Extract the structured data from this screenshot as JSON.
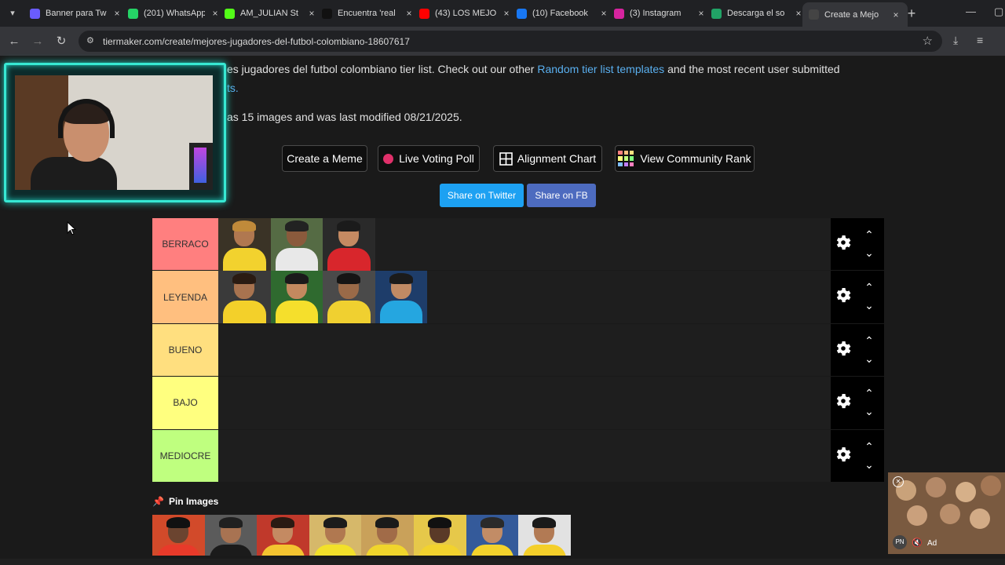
{
  "browser": {
    "tabs": [
      {
        "label": "Banner para Tw",
        "icon": "heart-icon",
        "color": "#6a5cff"
      },
      {
        "label": "(201) WhatsApp",
        "icon": "whatsapp-icon",
        "color": "#25d366"
      },
      {
        "label": "AM_JULIAN St",
        "icon": "kick-icon",
        "color": "#53fc18"
      },
      {
        "label": "Encuentra 'real",
        "icon": "tiktok-icon",
        "color": "#111111"
      },
      {
        "label": "(43) LOS MEJO",
        "icon": "youtube-icon",
        "color": "#ff0000"
      },
      {
        "label": "(10) Facebook",
        "icon": "facebook-icon",
        "color": "#1877f2"
      },
      {
        "label": "(3) Instagram",
        "icon": "instagram-icon",
        "color": "#d6249f"
      },
      {
        "label": "Descarga el so",
        "icon": "excel-icon",
        "color": "#21a366"
      },
      {
        "label": "Create a Mejo",
        "icon": "tiermaker-icon",
        "color": "#444444"
      }
    ],
    "url": "tiermaker.com/create/mejores-jugadores-del-futbol-colombiano-18607617"
  },
  "description": {
    "text1": "es jugadores del futbol colombiano tier list. Check out our other ",
    "link1": "Random tier list templates",
    "text2": " and the most recent user submitted",
    "link2": "ts.",
    "image_count_text": "as 15 images and was last modified 08/21/2025."
  },
  "buttons": {
    "meme": "Create a Meme",
    "poll": "Live Voting Poll",
    "alignment": "Alignment Chart",
    "community": "View Community Rank",
    "twitter": "Share on Twitter",
    "fb": "Share on FB"
  },
  "colors": {
    "twitter": "#1da1f2",
    "fb": "#4d6bbf",
    "accent_pin": "#e8336b",
    "cam_border": "#37e8d3"
  },
  "tiers": [
    {
      "label": "BERRACO",
      "color": "#ff7f7f",
      "players": 3
    },
    {
      "label": "LEYENDA",
      "color": "#ffbf7f",
      "players": 4
    },
    {
      "label": "BUENO",
      "color": "#ffdf7f",
      "players": 0
    },
    {
      "label": "BAJO",
      "color": "#ffff7f",
      "players": 0
    },
    {
      "label": "MEDIOCRE",
      "color": "#bfff7f",
      "players": 0
    }
  ],
  "pin": {
    "label": "Pin Images"
  },
  "ad": {
    "label": "Ad",
    "badge": "PN"
  }
}
